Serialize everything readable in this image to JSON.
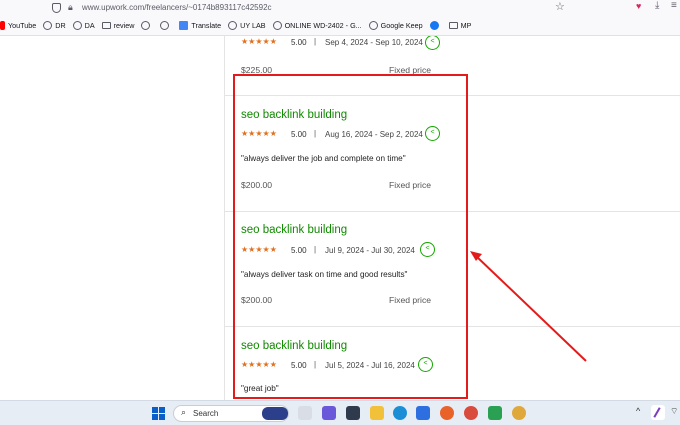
{
  "browser": {
    "url": "www.upwork.com/freelancers/~0174b893117c42592c",
    "bookmarks": [
      {
        "label": "YouTube",
        "icon": "youtube-icon"
      },
      {
        "label": "DR",
        "icon": "globe-icon"
      },
      {
        "label": "DA",
        "icon": "globe-icon"
      },
      {
        "label": "review",
        "icon": "folder-icon"
      },
      {
        "label": "",
        "icon": "globe-icon"
      },
      {
        "label": "",
        "icon": "globe-icon"
      },
      {
        "label": "Translate",
        "icon": "translate-icon"
      },
      {
        "label": "UY LAB",
        "icon": "globe-icon"
      },
      {
        "label": "ONLINE WD-2402 - G...",
        "icon": "globe-icon"
      },
      {
        "label": "Google Keep",
        "icon": "globe-icon"
      },
      {
        "label": "",
        "icon": "facebook-icon"
      },
      {
        "label": "MP",
        "icon": "folder-icon"
      }
    ]
  },
  "reviews": [
    {
      "title": "",
      "stars": "★★★★★",
      "rating": "5.00",
      "dates": "Sep 4, 2024 - Sep 10, 2024",
      "quote": "",
      "amount": "$225.00",
      "price_type": "Fixed price"
    },
    {
      "title": "seo backlink building",
      "stars": "★★★★★",
      "rating": "5.00",
      "dates": "Aug 16, 2024 - Sep 2, 2024",
      "quote": "\"always deliver the job and complete on time\"",
      "amount": "$200.00",
      "price_type": "Fixed price"
    },
    {
      "title": "seo backlink building",
      "stars": "★★★★★",
      "rating": "5.00",
      "dates": "Jul 9, 2024 - Jul 30, 2024",
      "quote": "\"always deliver task on time and good results\"",
      "amount": "$200.00",
      "price_type": "Fixed price"
    },
    {
      "title": "seo backlink building",
      "stars": "★★★★★",
      "rating": "5.00",
      "dates": "Jul 5, 2024 - Jul 16, 2024",
      "quote": "\"great job\"",
      "amount": "",
      "price_type": ""
    }
  ],
  "separator": "|",
  "taskbar": {
    "search_label": "Search"
  },
  "colors": {
    "accent_green": "#108a00",
    "star_orange": "#e0701c",
    "annotation_red": "#e41b1b"
  }
}
